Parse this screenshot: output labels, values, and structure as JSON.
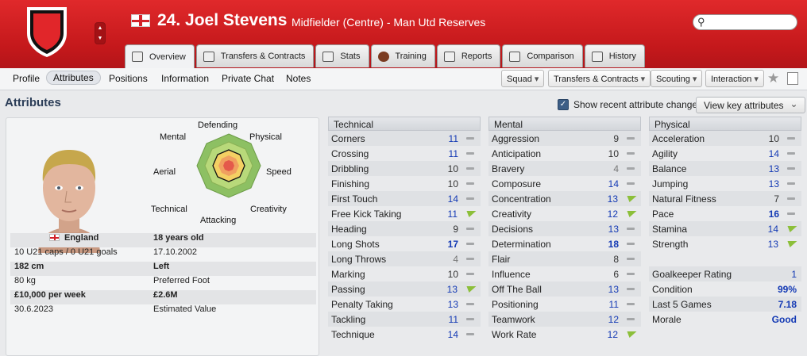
{
  "header": {
    "player_name": "24. Joel Stevens",
    "subtitle": "Midfielder (Centre) - Man Utd Reserves",
    "search_placeholder": ""
  },
  "tabs": [
    {
      "label": "Overview"
    },
    {
      "label": "Transfers & Contracts"
    },
    {
      "label": "Stats"
    },
    {
      "label": "Training"
    },
    {
      "label": "Reports"
    },
    {
      "label": "Comparison"
    },
    {
      "label": "History"
    }
  ],
  "subnav": [
    "Profile",
    "Attributes",
    "Positions",
    "Information",
    "Private Chat",
    "Notes"
  ],
  "dropdowns": [
    "Squad",
    "Transfers & Contracts",
    "Scouting",
    "Interaction"
  ],
  "page": {
    "title": "Attributes",
    "show_recent": "Show recent attribute changes",
    "view_key": "View key attributes"
  },
  "radar": {
    "labels": [
      "Defending",
      "Physical",
      "Speed",
      "Creativity",
      "Attacking",
      "Technical",
      "Aerial",
      "Mental"
    ]
  },
  "profile": {
    "nation": "England",
    "age": "18 years old",
    "caps": "10 U21 caps / 0 U21 goals",
    "dob": "17.10.2002",
    "height": "182 cm",
    "foot": "Left",
    "weight": "80 kg",
    "foot_label": "Preferred Foot",
    "wage": "£10,000 per week",
    "value": "£2.6M",
    "contract_end": "30.6.2023",
    "value_label": "Estimated Value"
  },
  "technical": {
    "title": "Technical",
    "rows": [
      {
        "name": "Corners",
        "value": "11",
        "trend": "same"
      },
      {
        "name": "Crossing",
        "value": "11",
        "trend": "same"
      },
      {
        "name": "Dribbling",
        "value": "10",
        "trend": "same"
      },
      {
        "name": "Finishing",
        "value": "10",
        "trend": "same"
      },
      {
        "name": "First Touch",
        "value": "14",
        "trend": "same"
      },
      {
        "name": "Free Kick Taking",
        "value": "11",
        "trend": "up"
      },
      {
        "name": "Heading",
        "value": "9",
        "trend": "same"
      },
      {
        "name": "Long Shots",
        "value": "17",
        "trend": "same"
      },
      {
        "name": "Long Throws",
        "value": "4",
        "trend": "same"
      },
      {
        "name": "Marking",
        "value": "10",
        "trend": "same"
      },
      {
        "name": "Passing",
        "value": "13",
        "trend": "up"
      },
      {
        "name": "Penalty Taking",
        "value": "13",
        "trend": "same"
      },
      {
        "name": "Tackling",
        "value": "11",
        "trend": "same"
      },
      {
        "name": "Technique",
        "value": "14",
        "trend": "same"
      }
    ]
  },
  "mental": {
    "title": "Mental",
    "rows": [
      {
        "name": "Aggression",
        "value": "9",
        "trend": "same"
      },
      {
        "name": "Anticipation",
        "value": "10",
        "trend": "same"
      },
      {
        "name": "Bravery",
        "value": "4",
        "trend": "same"
      },
      {
        "name": "Composure",
        "value": "14",
        "trend": "same"
      },
      {
        "name": "Concentration",
        "value": "13",
        "trend": "up"
      },
      {
        "name": "Creativity",
        "value": "12",
        "trend": "up"
      },
      {
        "name": "Decisions",
        "value": "13",
        "trend": "same"
      },
      {
        "name": "Determination",
        "value": "18",
        "trend": "same"
      },
      {
        "name": "Flair",
        "value": "8",
        "trend": "same"
      },
      {
        "name": "Influence",
        "value": "6",
        "trend": "same"
      },
      {
        "name": "Off The Ball",
        "value": "13",
        "trend": "same"
      },
      {
        "name": "Positioning",
        "value": "11",
        "trend": "same"
      },
      {
        "name": "Teamwork",
        "value": "12",
        "trend": "same"
      },
      {
        "name": "Work Rate",
        "value": "12",
        "trend": "up"
      }
    ]
  },
  "physical": {
    "title": "Physical",
    "rows": [
      {
        "name": "Acceleration",
        "value": "10",
        "trend": "same"
      },
      {
        "name": "Agility",
        "value": "14",
        "trend": "same"
      },
      {
        "name": "Balance",
        "value": "13",
        "trend": "same"
      },
      {
        "name": "Jumping",
        "value": "13",
        "trend": "same"
      },
      {
        "name": "Natural Fitness",
        "value": "7",
        "trend": "same"
      },
      {
        "name": "Pace",
        "value": "16",
        "trend": "same"
      },
      {
        "name": "Stamina",
        "value": "14",
        "trend": "up"
      },
      {
        "name": "Strength",
        "value": "13",
        "trend": "up"
      }
    ],
    "extra": [
      {
        "name": "Goalkeeper Rating",
        "value": "1"
      },
      {
        "name": "Condition",
        "value": "99%"
      },
      {
        "name": "Last 5 Games",
        "value": "7.18"
      },
      {
        "name": "Morale",
        "value": "Good"
      }
    ]
  }
}
